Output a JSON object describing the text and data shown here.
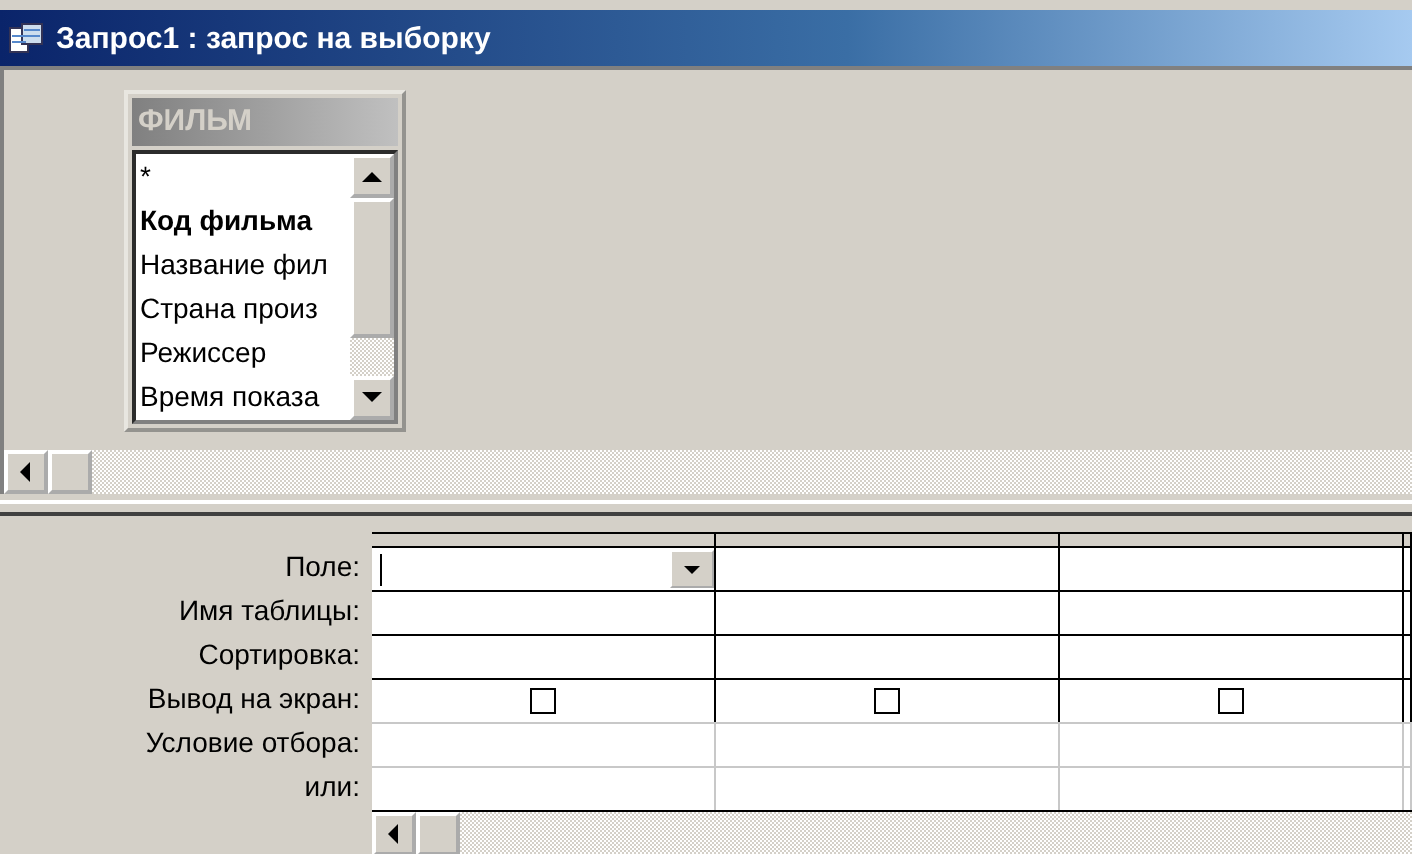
{
  "window": {
    "title": "Запрос1 : запрос на выборку"
  },
  "table_list": [
    {
      "title": "ФИЛЬМ",
      "fields": [
        {
          "label": "*",
          "key": false
        },
        {
          "label": "Код фильма",
          "key": true
        },
        {
          "label": "Название фил",
          "key": false
        },
        {
          "label": "Страна произ",
          "key": false
        },
        {
          "label": "Режиссер",
          "key": false
        },
        {
          "label": "Время показа",
          "key": false
        }
      ]
    }
  ],
  "grid": {
    "row_labels": [
      "Поле:",
      "Имя таблицы:",
      "Сортировка:",
      "Вывод на экран:",
      "Условие отбора:",
      "или:"
    ],
    "columns": [
      {
        "focused": true,
        "show": false
      },
      {
        "focused": false,
        "show": false
      },
      {
        "focused": false,
        "show": false
      }
    ]
  }
}
